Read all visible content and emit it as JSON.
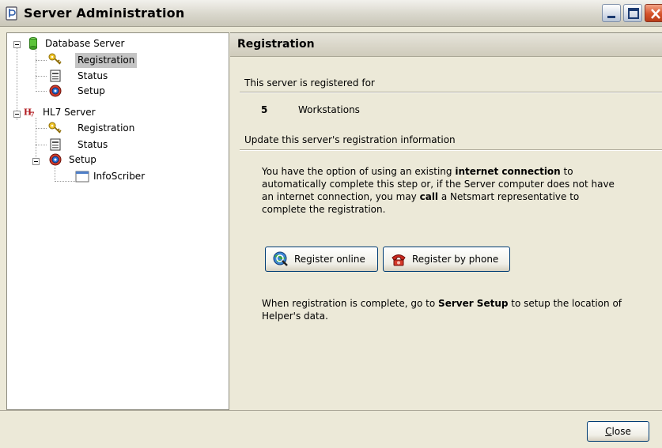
{
  "window": {
    "title": "Server Administration"
  },
  "tree": {
    "items": [
      {
        "label": "Database Server",
        "icon": "database-icon"
      },
      {
        "label": "Registration",
        "icon": "key-icon"
      },
      {
        "label": "Status",
        "icon": "status-icon"
      },
      {
        "label": "Setup",
        "icon": "setup-icon"
      },
      {
        "label": "HL7 Server",
        "icon": "hl7-icon"
      },
      {
        "label": "Registration",
        "icon": "key-icon"
      },
      {
        "label": "Status",
        "icon": "status-icon"
      },
      {
        "label": "Setup",
        "icon": "setup-icon"
      },
      {
        "label": "InfoScriber",
        "icon": "window-icon"
      }
    ],
    "selected": "Registration"
  },
  "panel": {
    "title": "Registration",
    "registered_label": "This server is registered for",
    "count": "5",
    "count_unit": "Workstations",
    "update_label": "Update this server's registration information",
    "info_p1_a": "You have the option of using an existing ",
    "info_p1_b": "internet connection",
    "info_p1_c": "  to automatically complete this step or, if the Server computer does not have  an internet connection, you may ",
    "info_p1_d": "call",
    "info_p1_e": " a Netsmart  representative to complete the registration.",
    "info_p2_a": "When registration is complete, go to ",
    "info_p2_b": "Server Setup",
    "info_p2_c": " to setup  the location of Helper's data.",
    "register_online_label": "Register online",
    "register_phone_label": "Register by phone"
  },
  "footer": {
    "close_label_first": "C",
    "close_label_rest": "lose"
  },
  "colors": {
    "background": "#ece9d8",
    "selection": "#c4c4c4",
    "button_border": "#003c74"
  }
}
